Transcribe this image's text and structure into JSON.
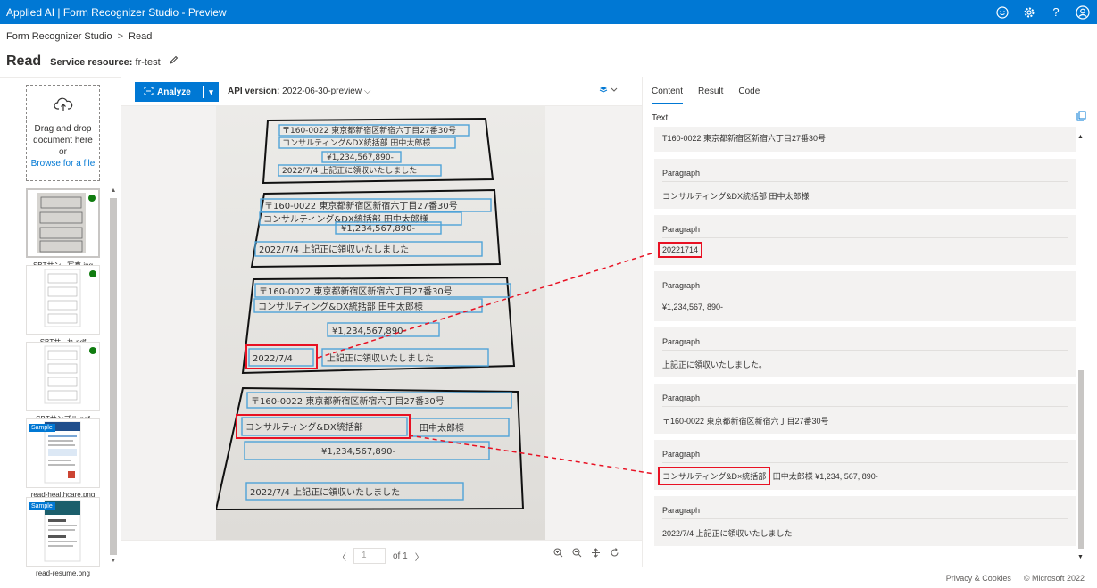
{
  "topbar": {
    "title": "Applied AI | Form Recognizer Studio - Preview"
  },
  "breadcrumb": {
    "root": "Form Recognizer Studio",
    "separator": ">",
    "current": "Read"
  },
  "page": {
    "title": "Read",
    "service_label": "Service resource:",
    "service_value": "fr-test"
  },
  "dropzone": {
    "line1": "Drag and drop",
    "line2": "document here",
    "line3": "or",
    "link": "Browse for a file"
  },
  "files": [
    {
      "name": "SBTサン...写真.jpg",
      "status": "analyzed"
    },
    {
      "name": "SBTサ...れ.pdf",
      "status": "analyzed"
    },
    {
      "name": "SBTサンプル.pdf",
      "status": "analyzed"
    },
    {
      "name": "read-healthcare.png",
      "badge": "Sample"
    },
    {
      "name": "read-resume.png",
      "badge": "Sample"
    }
  ],
  "toolbar": {
    "analyze_label": "Analyze",
    "api_label": "API version:",
    "api_value": "2022-06-30-preview"
  },
  "pager": {
    "page_value": "1",
    "of_label": "of 1"
  },
  "tabs": [
    "Content",
    "Result",
    "Code"
  ],
  "text_header": "Text",
  "paragraphs": [
    {
      "label": "",
      "text": "T160-0022 東京都新宿区新宿六丁目27番30号"
    },
    {
      "label": "Paragraph",
      "text": "コンサルティング&DX統括部 田中太郎様"
    },
    {
      "label": "Paragraph",
      "text": "20221714"
    },
    {
      "label": "Paragraph",
      "text": "¥1,234,567, 890-"
    },
    {
      "label": "Paragraph",
      "text": "上記正に領収いたしました。"
    },
    {
      "label": "Paragraph",
      "text": "〒160-0022 東京都新宿区新宿六丁目27番30号"
    },
    {
      "label": "Paragraph",
      "text_highlight": "コンサルティング&D×統括部",
      "text_rest": " 田中太郎様 ¥1,234, 567, 890-"
    },
    {
      "label": "Paragraph",
      "text": "2022/7/4 上記正に領収いたしました"
    }
  ],
  "document_lines": {
    "block1": [
      "〒160-0022 東京都新宿区新宿六丁目27番30号",
      "コンサルティング&DX統括部 田中太郎様",
      "¥1,234,567,890-",
      "2022/7/4 上記正に領収いたしました"
    ],
    "block2": [
      "〒160-0022 東京都新宿区新宿六丁目27番30号",
      "コンサルティング&DX統括部 田中太郎様",
      "¥1,234,567,890-",
      "2022/7/4 上記正に領収いたしました"
    ],
    "block3": [
      "〒160-0022 東京都新宿区新宿六丁目27番30号",
      "コンサルティング&DX統括部 田中太郎様",
      "¥1,234,567,890-",
      "2022/7/4",
      "上記正に領収いたしました"
    ],
    "block4": [
      "〒160-0022 東京都新宿区新宿六丁目27番30号",
      "コンサルティング&DX統括部",
      "田中太郎様",
      "¥1,234,567,890-",
      "2022/7/4 上記正に領収いたしました"
    ]
  },
  "footer": {
    "privacy": "Privacy & Cookies",
    "copyright": "© Microsoft 2022"
  },
  "colors": {
    "brand": "#0078d4",
    "highlight": "#e81123",
    "status_ok": "#107c10",
    "ocr_box": "#4fa3d8"
  }
}
